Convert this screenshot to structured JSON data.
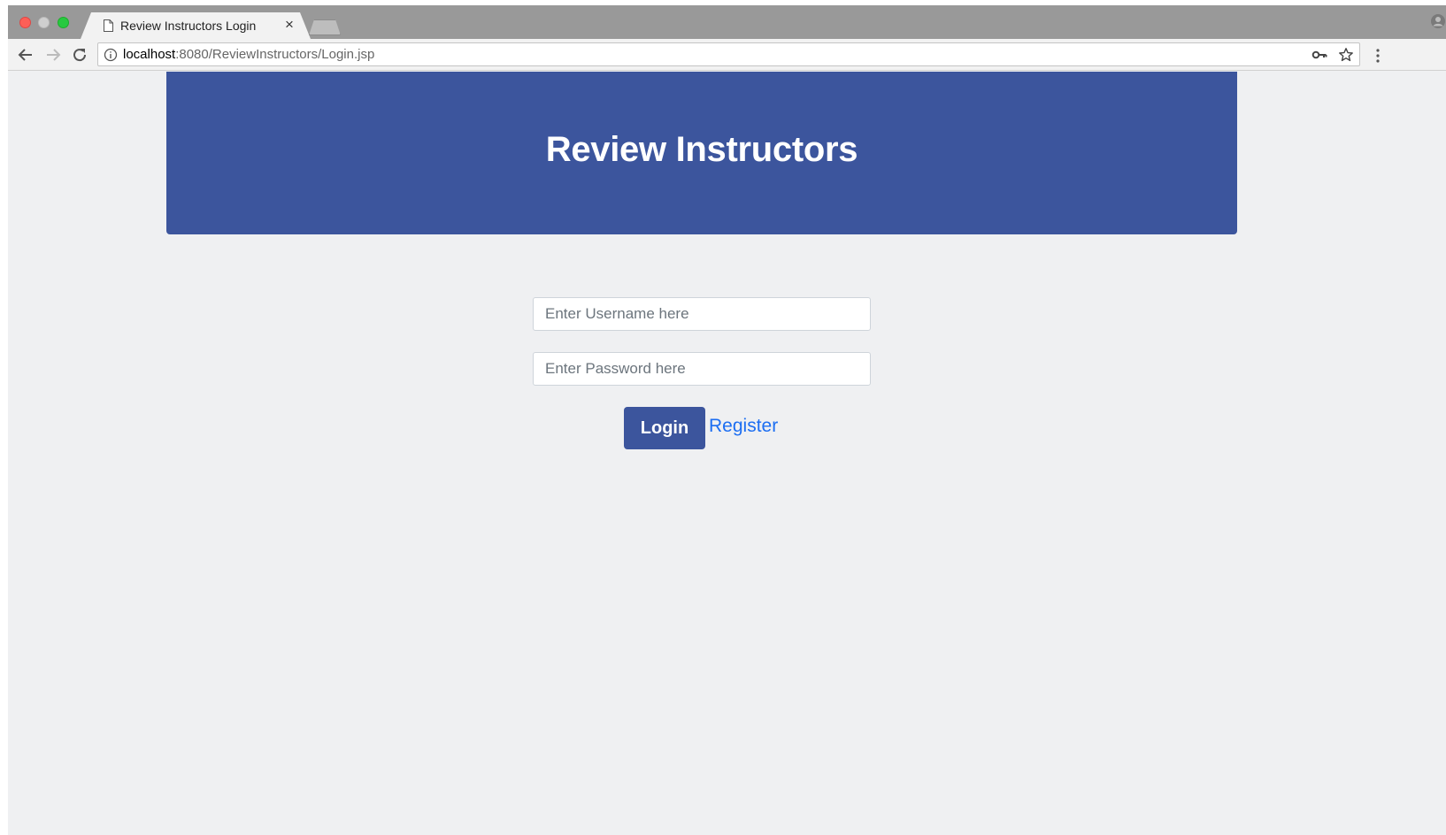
{
  "browser": {
    "tab": {
      "title": "Review Instructors Login",
      "close_glyph": "×"
    },
    "address_bar": {
      "host": "localhost",
      "path": ":8080/ReviewInstructors/Login.jsp"
    },
    "icons": [
      "back-arrow-icon",
      "forward-arrow-icon",
      "reload-icon",
      "info-icon",
      "key-icon",
      "star-icon",
      "menu-icon",
      "profile-icon",
      "document-icon"
    ]
  },
  "page": {
    "header": {
      "title": "Review Instructors"
    },
    "form": {
      "username": {
        "placeholder": "Enter Username here",
        "value": ""
      },
      "password": {
        "placeholder": "Enter Password here",
        "value": ""
      },
      "login_label": "Login",
      "register_label": "Register"
    }
  },
  "colors": {
    "brand": "#3c559d",
    "link": "#1c6ef2",
    "page_background": "#eff0f2"
  }
}
